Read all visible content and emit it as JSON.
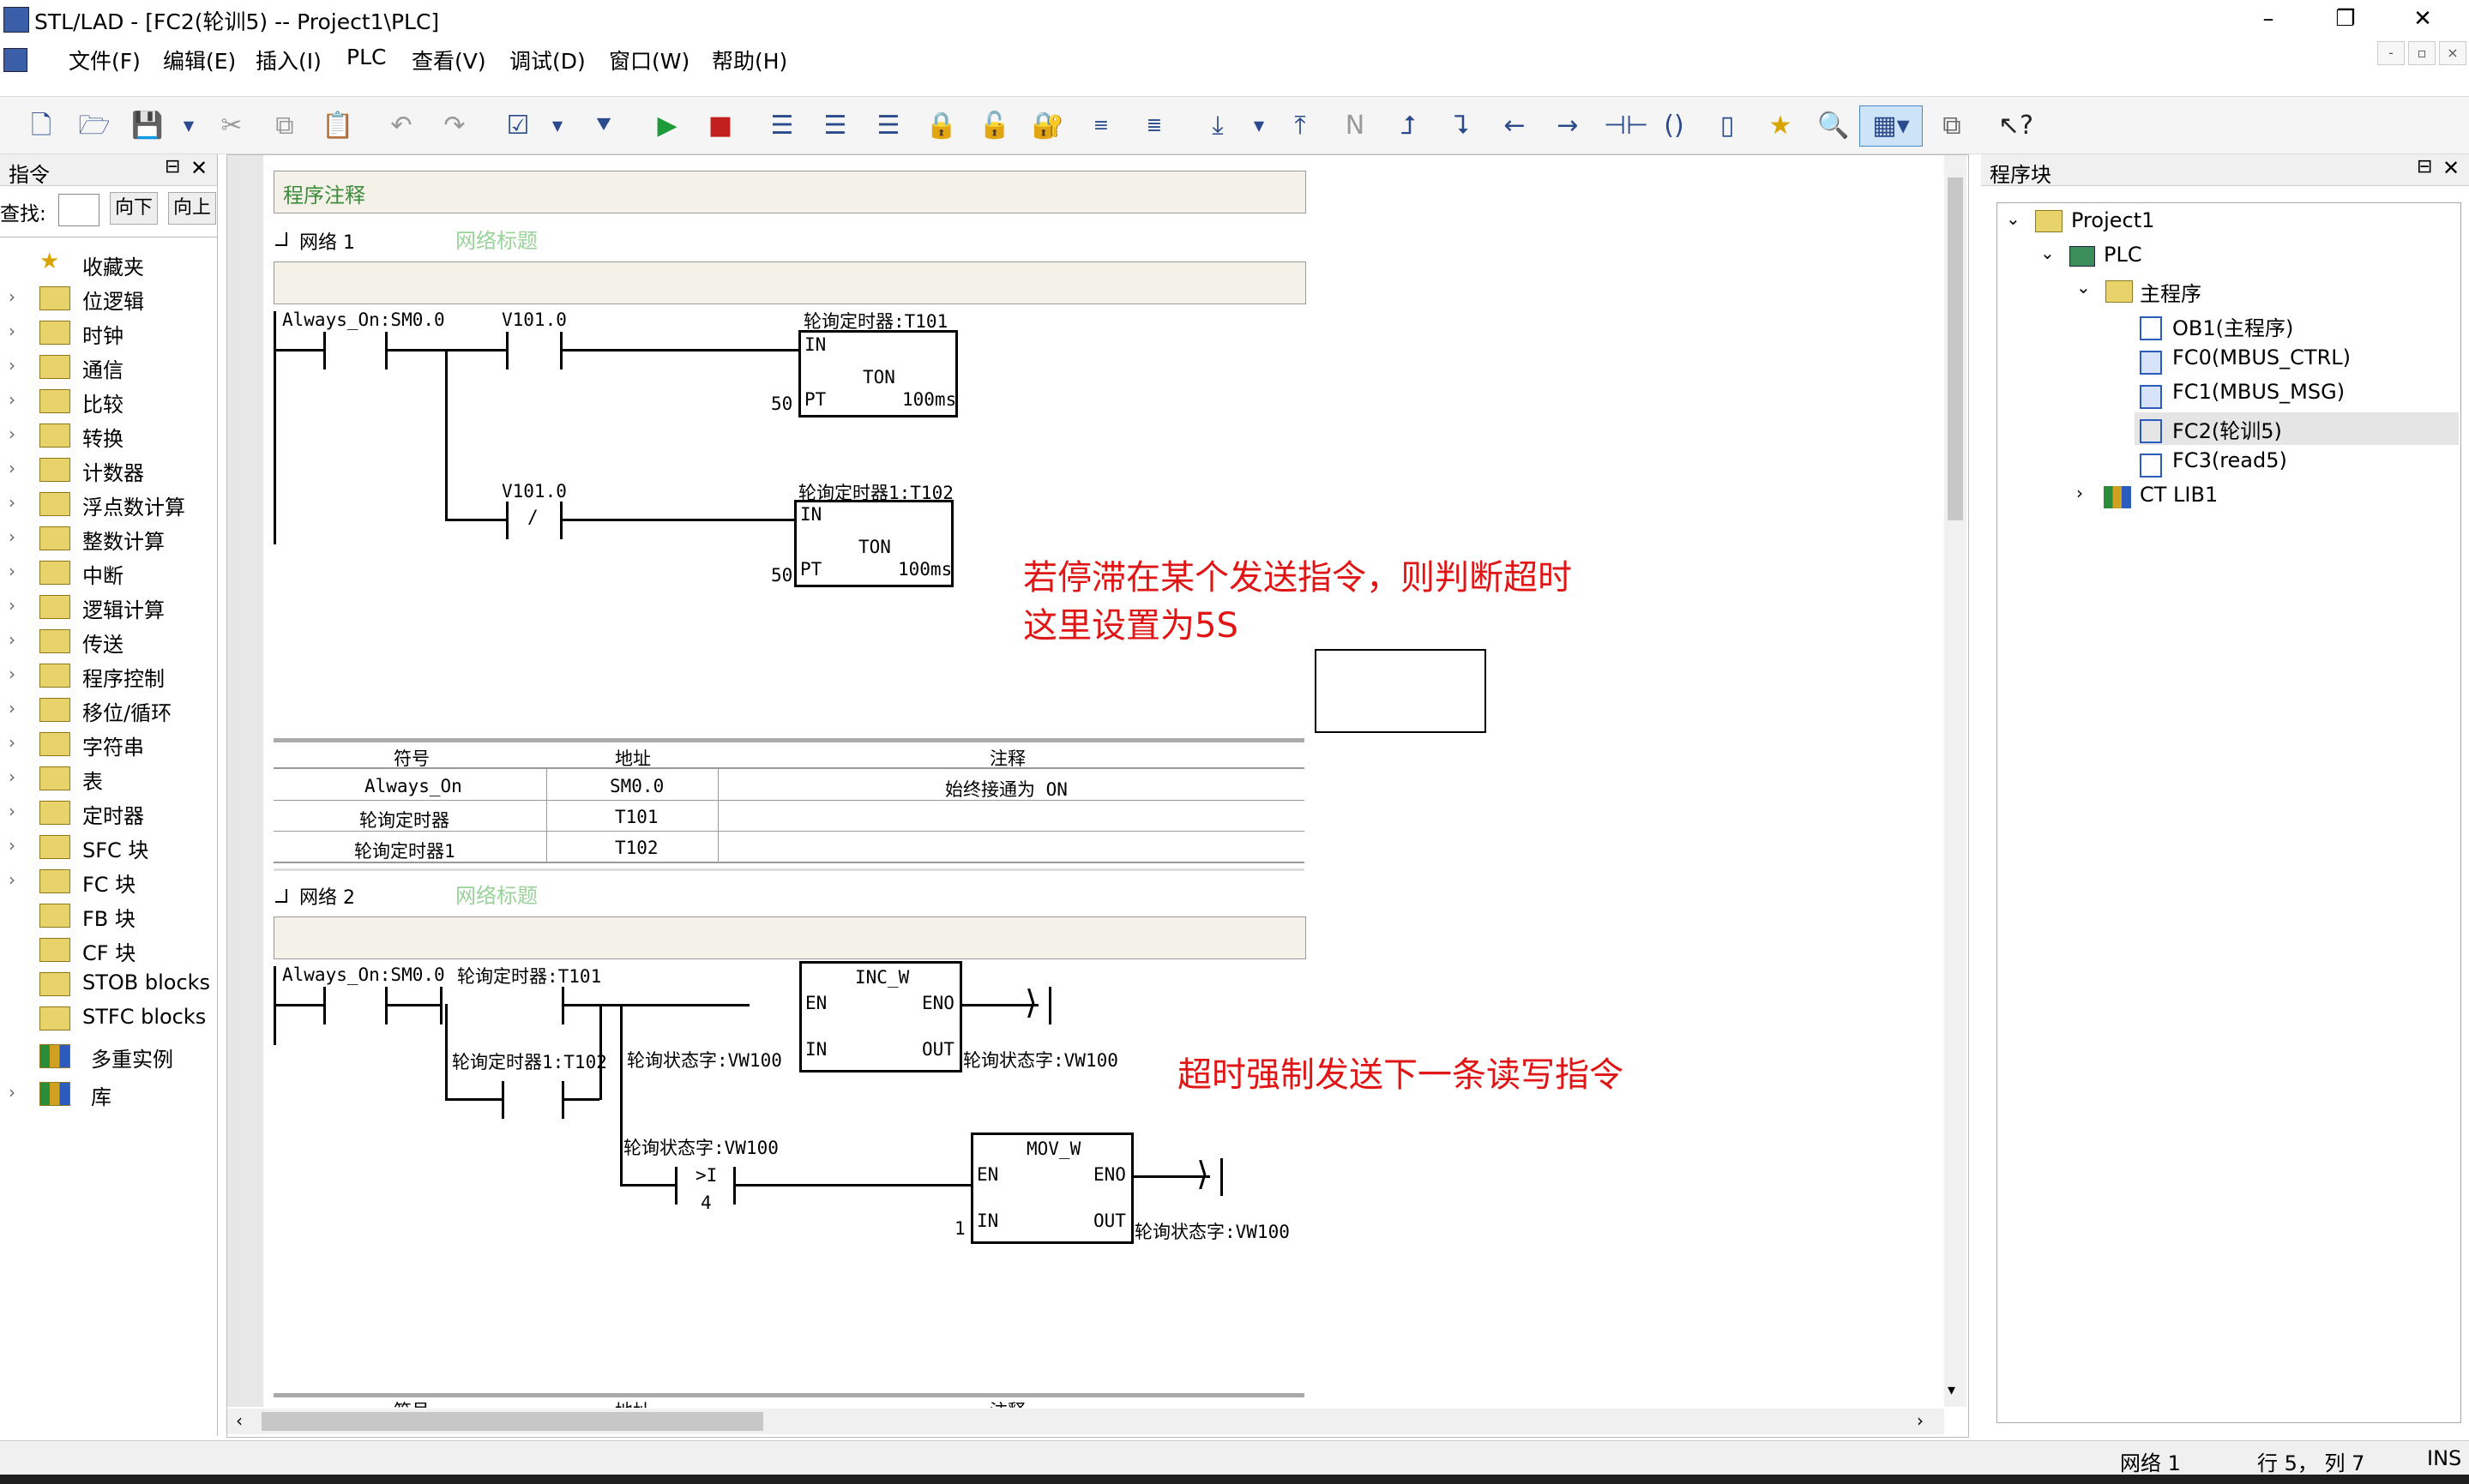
{
  "window": {
    "title": "STL/LAD - [FC2(轮训5) -- Project1\\PLC]"
  },
  "menu": [
    "文件(F)",
    "编辑(E)",
    "插入(I)",
    "PLC",
    "查看(V)",
    "调试(D)",
    "窗口(W)",
    "帮助(H)"
  ],
  "left_panel": {
    "title": "指令",
    "search_label": "查找:",
    "down_button": "向下",
    "up_button": "向上",
    "items": [
      "收藏夹",
      "位逻辑",
      "时钟",
      "通信",
      "比较",
      "转换",
      "计数器",
      "浮点数计算",
      "整数计算",
      "中断",
      "逻辑计算",
      "传送",
      "程序控制",
      "移位/循环",
      "字符串",
      "表",
      "定时器",
      "SFC 块",
      "FC 块",
      "FB 块",
      "CF 块",
      "STOB blocks",
      "STFC blocks",
      "多重实例",
      "库"
    ]
  },
  "editor": {
    "program_comment": "程序注释",
    "network1": {
      "label": "网络 1",
      "title_hint": "网络标题"
    },
    "network2": {
      "label": "网络 2",
      "title_hint": "网络标题"
    },
    "n1": {
      "c1": "Always_On:SM0.0",
      "c2": "V101.0",
      "c3": "V101.0",
      "c3_sym": "/",
      "t1_name": "轮询定时器:T101",
      "t2_name": "轮询定时器1:T102",
      "ton_in": "IN",
      "ton_type": "TON",
      "ton_pt": "PT",
      "ton_base": "100ms",
      "pt_value": "50"
    },
    "symtable": {
      "headers": [
        "符号",
        "地址",
        "注释"
      ],
      "rows": [
        [
          "Always_On",
          "SM0.0",
          "始终接通为 ON"
        ],
        [
          "轮询定时器",
          "T101",
          ""
        ],
        [
          "轮询定时器1",
          "T102",
          ""
        ]
      ],
      "partial_headers": [
        "符号",
        "地址",
        "注释"
      ]
    },
    "n2": {
      "c1": "Always_On:SM0.0",
      "c2": "轮询定时器:T101",
      "c3": "轮询定时器1:T102",
      "inc_title": "INC_W",
      "en": "EN",
      "eno": "ENO",
      "in": "IN",
      "out": "OUT",
      "inc_in": "轮询状态字:VW100",
      "inc_out": "轮询状态字:VW100",
      "cmp_name": "轮询状态字:VW100",
      "cmp_op": ">I",
      "cmp_val": "4",
      "mov_title": "MOV_W",
      "mov_in_val": "1",
      "mov_out": "轮询状态字:VW100"
    },
    "annotation1_line1": "若停滞在某个发送指令，则判断超时",
    "annotation1_line2": "这里设置为5S",
    "annotation2": "超时强制发送下一条读写指令"
  },
  "right_panel": {
    "title": "程序块",
    "tree": {
      "project": "Project1",
      "plc": "PLC",
      "main": "主程序",
      "blocks": [
        "OB1(主程序)",
        "FC0(MBUS_CTRL)",
        "FC1(MBUS_MSG)",
        "FC2(轮训5)",
        "FC3(read5)"
      ],
      "lib": "CT LIB1"
    }
  },
  "status": {
    "network": "网络 1",
    "position": "行 5，  列 7",
    "mode": "INS"
  },
  "colors": {
    "annotation": "#e01515",
    "selected_row": "#e5e5e5",
    "comment_bg": "#f4f2e8"
  }
}
